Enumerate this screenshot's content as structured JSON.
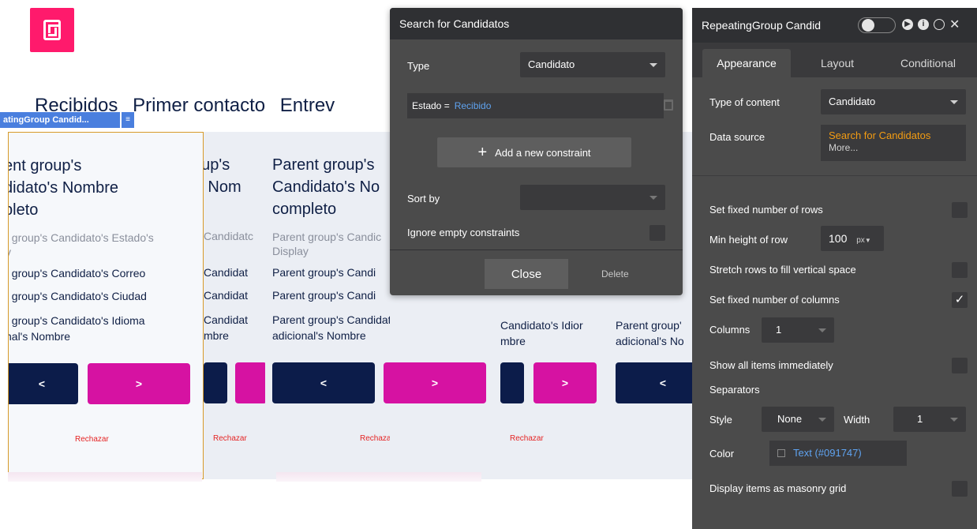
{
  "canvas": {
    "tabs": [
      "Recibidos",
      "Primer contacto",
      "Entrev"
    ],
    "rg_badge": "atingGroup Candid...",
    "cell_title": "Parent group's\nCandidato's Nombre\ncompleto",
    "cell_estado": "Parent group's Candidato's Estado's\nDisplay",
    "cell_correo": "Parent group's Candidato's Correo",
    "cell_ciudad": "Parent group's Candidato's Ciudad",
    "cell_idioma": "Parent group's Candidato's Idioma\nadicional's Nombre",
    "cell_c1_title": "ent group's\ndidato's Nombre\npleto",
    "cell_c1_estado": "t group's Candidato's Estado's\ny",
    "cell_c1_correo": "t group's Candidato's Correo",
    "cell_c1_ciudad": "t group's Candidato's Ciudad",
    "cell_c1_idioma": "t group's Candidato's Idioma\nnal's Nombre",
    "cell_c2_title": "oup's\n's Nom",
    "cell_c2_estado": "Candidatc",
    "cell_c2_correo": "Candidat",
    "cell_c2_ciudad": "Candidat",
    "cell_c2_idioma": "Candidat\nmbre",
    "cell_c3_title": "Parent group's\nCandidato's No\ncompleto",
    "cell_c3_estado": "Parent group's Candic\nDisplay",
    "cell_c3_correo": "Parent group's Candi",
    "cell_c3_ciudad": "Parent group's Candi",
    "cell_c4_idioma": "Candidato's Idior\nmbre",
    "cell_c5_idioma": "Parent group'\nadicional's No",
    "prev_label": "<",
    "next_label": ">",
    "reject_label": "Rechazar"
  },
  "search_panel": {
    "title": "Search for Candidatos",
    "type_label": "Type",
    "type_value": "Candidato",
    "constraint_key": "Estado =",
    "constraint_value": "Recibido",
    "add_constraint": "Add a new constraint",
    "sort_by_label": "Sort by",
    "sort_by_value": "",
    "ignore_empty_label": "Ignore empty constraints",
    "close_label": "Close",
    "delete_label": "Delete"
  },
  "property_editor": {
    "title": "RepeatingGroup Candid",
    "tabs": [
      "Appearance",
      "Layout",
      "Conditional"
    ],
    "type_of_content_label": "Type of content",
    "type_of_content_value": "Candidato",
    "data_source_label": "Data source",
    "data_source_value": "Search for Candidatos",
    "data_source_more": "More...",
    "fixed_rows_label": "Set fixed number of rows",
    "min_height_label": "Min height of row",
    "min_height_value": "100",
    "min_height_unit": "px",
    "stretch_rows_label": "Stretch rows to fill vertical space",
    "fixed_columns_label": "Set fixed number of columns",
    "fixed_columns_checked": true,
    "columns_label": "Columns",
    "columns_value": "1",
    "show_all_label": "Show all items immediately",
    "separators_label": "Separators",
    "style_label": "Style",
    "style_value": "None",
    "width_label": "Width",
    "width_value": "1",
    "color_label": "Color",
    "color_value": "Text (#091747)",
    "masonry_label": "Display items as masonry grid"
  },
  "colors": {
    "brand_pink": "#ff1a6c",
    "button_navy": "#0c1c4a",
    "button_magenta": "#d612a2",
    "link_blue": "#5fa3f0",
    "data_source_orange": "#f39c12",
    "panel_bg": "#4b4b4b",
    "panel_header": "#2f3033"
  }
}
